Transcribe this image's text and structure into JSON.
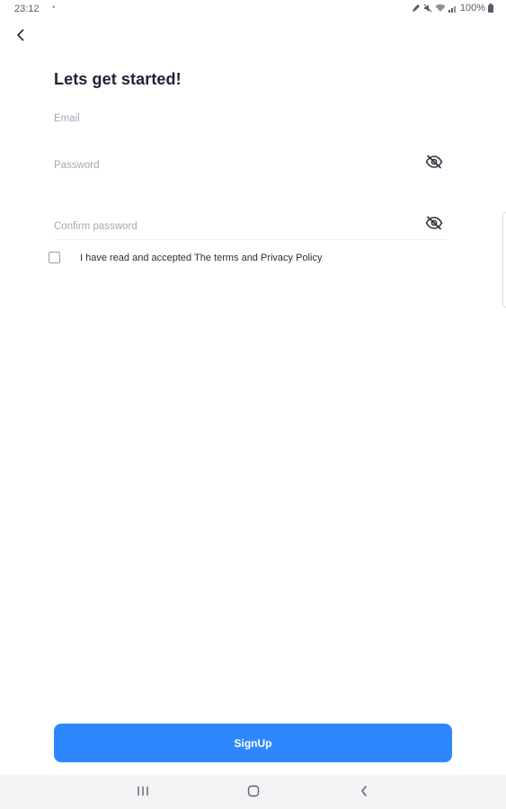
{
  "status_bar": {
    "time": "23:12",
    "dot": "•",
    "battery": "100%"
  },
  "page": {
    "title": "Lets get started!"
  },
  "form": {
    "email_placeholder": "Email",
    "password_placeholder": "Password",
    "confirm_placeholder": "Confirm password",
    "terms_text": "I have read and accepted The terms and Privacy Policy",
    "terms_checked": false
  },
  "actions": {
    "signup_label": "SignUp"
  },
  "colors": {
    "accent": "#2f87ff",
    "title": "#1d2333",
    "placeholder": "#a3a9b6"
  },
  "icons": {
    "back": "chevron-left-icon",
    "eye_hidden": "eye-off-icon",
    "nav_recents": "recents-icon",
    "nav_home": "home-icon",
    "nav_back": "back-icon"
  }
}
